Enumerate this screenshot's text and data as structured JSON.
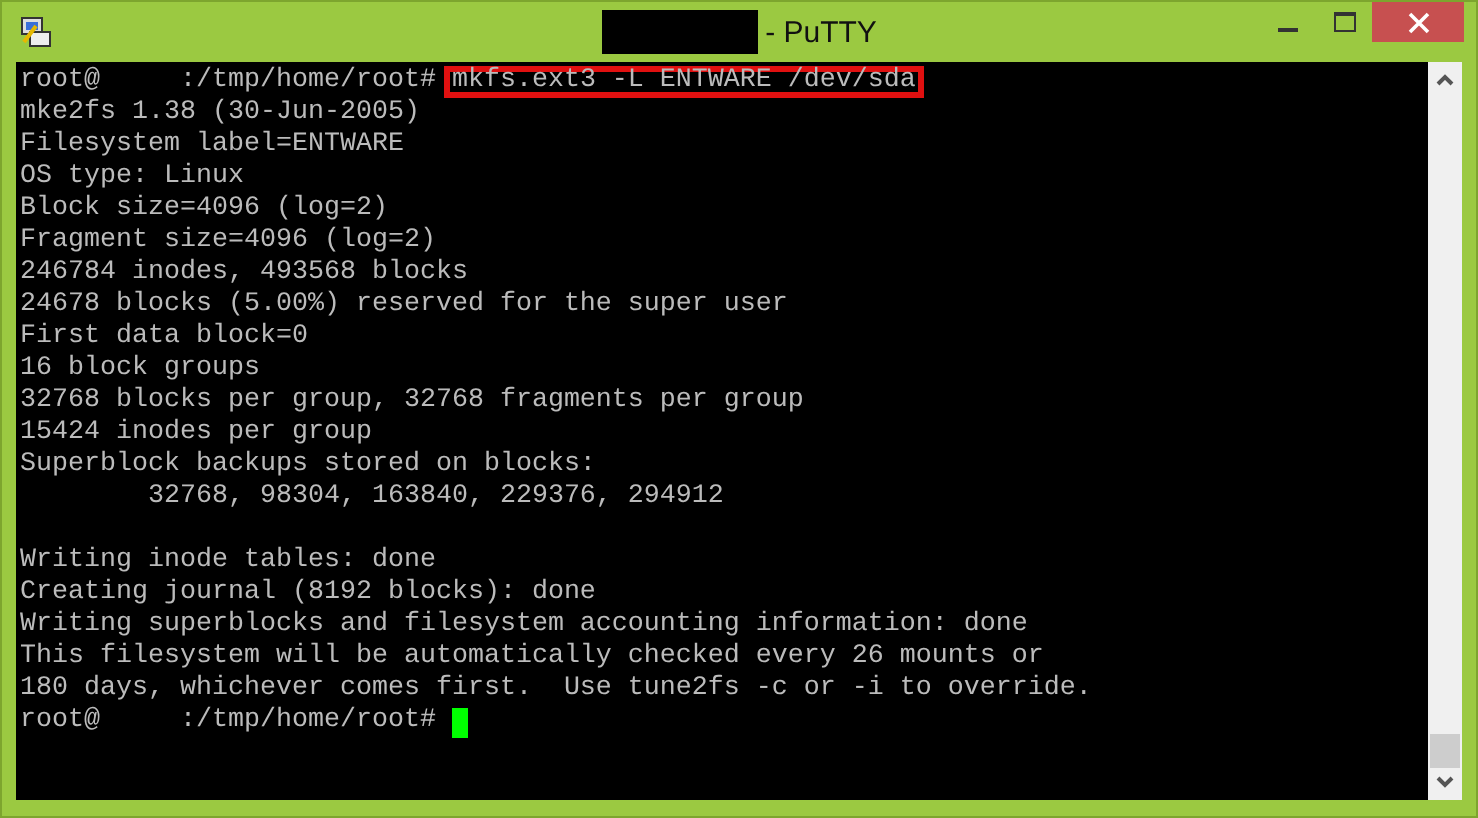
{
  "window": {
    "title": "- PuTTY"
  },
  "terminal": {
    "lines": [
      {
        "kind": "prompt",
        "prompt": "root@     :/tmp/home/root#",
        "command": "mkfs.ext3 -L ENTWARE /dev/sda",
        "highlighted": true
      },
      {
        "kind": "output",
        "text": "mke2fs 1.38 (30-Jun-2005)"
      },
      {
        "kind": "output",
        "text": "Filesystem label=ENTWARE"
      },
      {
        "kind": "output",
        "text": "OS type: Linux"
      },
      {
        "kind": "output",
        "text": "Block size=4096 (log=2)"
      },
      {
        "kind": "output",
        "text": "Fragment size=4096 (log=2)"
      },
      {
        "kind": "output",
        "text": "246784 inodes, 493568 blocks"
      },
      {
        "kind": "output",
        "text": "24678 blocks (5.00%) reserved for the super user"
      },
      {
        "kind": "output",
        "text": "First data block=0"
      },
      {
        "kind": "output",
        "text": "16 block groups"
      },
      {
        "kind": "output",
        "text": "32768 blocks per group, 32768 fragments per group"
      },
      {
        "kind": "output",
        "text": "15424 inodes per group"
      },
      {
        "kind": "output",
        "text": "Superblock backups stored on blocks:"
      },
      {
        "kind": "output",
        "text": "        32768, 98304, 163840, 229376, 294912"
      },
      {
        "kind": "blank"
      },
      {
        "kind": "output",
        "text": "Writing inode tables: done"
      },
      {
        "kind": "output",
        "text": "Creating journal (8192 blocks): done"
      },
      {
        "kind": "output",
        "text": "Writing superblocks and filesystem accounting information: done"
      },
      {
        "kind": "output",
        "text": "This filesystem will be automatically checked every 26 mounts or"
      },
      {
        "kind": "output",
        "text": "180 days, whichever comes first.  Use tune2fs -c or -i to override."
      },
      {
        "kind": "prompt",
        "prompt": "root@     :/tmp/home/root#",
        "cursor": true
      }
    ]
  }
}
